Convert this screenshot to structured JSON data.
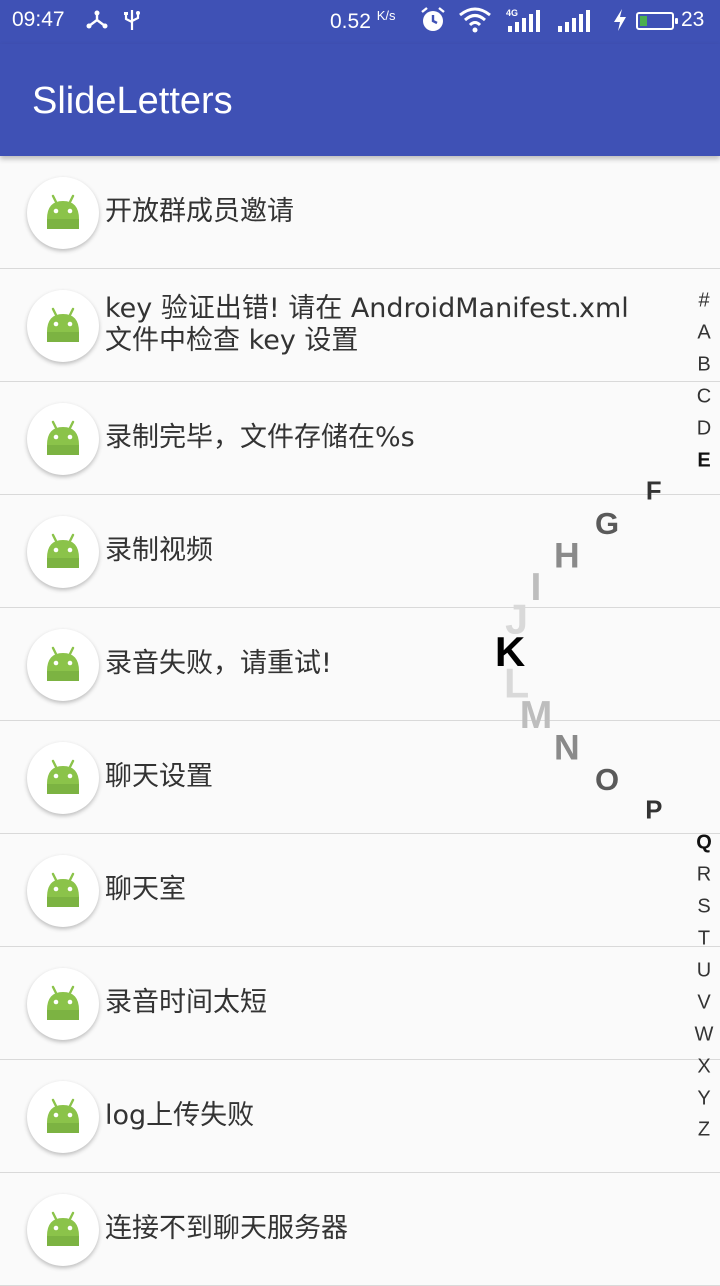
{
  "status_bar": {
    "time": "09:47",
    "network_speed": "0.52",
    "network_speed_unit": "K/s",
    "network_type": "4G",
    "battery_level": "23",
    "left_icons": [
      "usb-icon",
      "debug-icon"
    ],
    "right_icons": [
      "alarm-icon",
      "wifi-icon",
      "signal-4g-icon",
      "signal-icon",
      "charging-icon"
    ]
  },
  "app_bar": {
    "title": "SlideLetters"
  },
  "colors": {
    "primary": "#3f51b5",
    "android_green": "#8bc34a",
    "background": "#fafafa",
    "divider": "#d9d9d9"
  },
  "list": {
    "items": [
      {
        "label": "开放群成员邀请",
        "icon": "android-icon"
      },
      {
        "label": "key 验证出错! 请在 AndroidManifest.xml 文件中检查 key 设置",
        "icon": "android-icon"
      },
      {
        "label": "录制完毕，文件存储在%s",
        "icon": "android-icon"
      },
      {
        "label": "录制视频",
        "icon": "android-icon"
      },
      {
        "label": "录音失败，请重试!",
        "icon": "android-icon"
      },
      {
        "label": "聊天设置",
        "icon": "android-icon"
      },
      {
        "label": "聊天室",
        "icon": "android-icon"
      },
      {
        "label": "录音时间太短",
        "icon": "android-icon"
      },
      {
        "label": "log上传失败",
        "icon": "android-icon"
      },
      {
        "label": "连接不到聊天服务器",
        "icon": "android-icon"
      }
    ]
  },
  "letter_index": {
    "letters": [
      "#",
      "A",
      "B",
      "C",
      "D",
      "E",
      "F",
      "G",
      "H",
      "I",
      "J",
      "K",
      "L",
      "M",
      "N",
      "O",
      "P",
      "Q",
      "R",
      "S",
      "T",
      "U",
      "V",
      "W",
      "X",
      "Y",
      "Z"
    ],
    "selected": "K"
  }
}
